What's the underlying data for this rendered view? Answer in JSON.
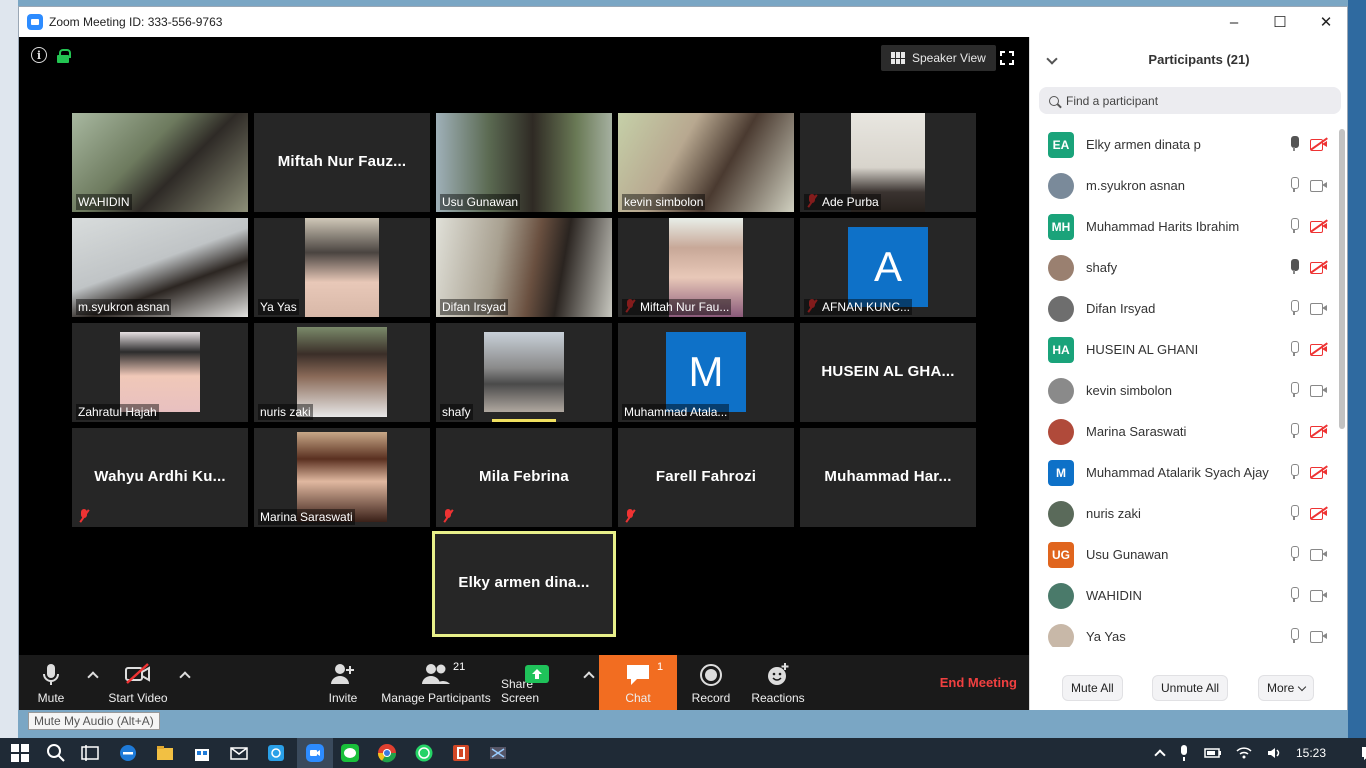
{
  "window": {
    "title": "Zoom Meeting ID: 333-556-9763",
    "controls": [
      "–",
      "☐",
      "✕"
    ]
  },
  "video": {
    "speaker_view_label": "Speaker View",
    "tiles": [
      {
        "name": "WAHIDIN",
        "type": "video",
        "muted": false
      },
      {
        "name": "Miftah Nur Fauz...",
        "type": "name",
        "muted": false
      },
      {
        "name": "Usu Gunawan",
        "type": "video",
        "muted": false
      },
      {
        "name": "kevin simbolon",
        "type": "video",
        "muted": false
      },
      {
        "name": "Ade Purba",
        "type": "video",
        "muted": true
      },
      {
        "name": "m.syukron asnan",
        "type": "video",
        "muted": false
      },
      {
        "name": "Ya Yas",
        "type": "video",
        "muted": false
      },
      {
        "name": "Difan Irsyad",
        "type": "video",
        "muted": false
      },
      {
        "name": "Miftah Nur Fau...",
        "type": "video",
        "muted": true
      },
      {
        "name": "AFNAN KUNC...",
        "type": "avatar",
        "letter": "A",
        "muted": true
      },
      {
        "name": "Zahratul Hajah",
        "type": "video",
        "muted": false
      },
      {
        "name": "nuris zaki",
        "type": "video",
        "muted": false
      },
      {
        "name": "shafy",
        "type": "video",
        "muted": false
      },
      {
        "name": "Muhammad Atala...",
        "type": "avatar",
        "letter": "M",
        "muted": false
      },
      {
        "name": "HUSEIN AL GHA...",
        "type": "name",
        "muted": false
      },
      {
        "name": "Wahyu Ardhi Ku...",
        "type": "name",
        "muted": true
      },
      {
        "name": "Marina Saraswati",
        "type": "video",
        "muted": false
      },
      {
        "name": "Mila Febrina",
        "type": "name",
        "muted": true
      },
      {
        "name": "Farell Fahrozi",
        "type": "name",
        "muted": true
      },
      {
        "name": "Muhammad Har...",
        "type": "name",
        "muted": false
      },
      {
        "name": "Elky armen dina...",
        "type": "name",
        "muted": false,
        "active": true
      }
    ]
  },
  "toolbar": {
    "mute_label": "Mute",
    "start_video_label": "Start Video",
    "invite_label": "Invite",
    "manage_participants_label": "Manage Participants",
    "participants_count": "21",
    "share_screen_label": "Share Screen",
    "chat_label": "Chat",
    "chat_badge": "1",
    "record_label": "Record",
    "reactions_label": "Reactions",
    "end_meeting_label": "End Meeting"
  },
  "tooltip": "Mute My Audio (Alt+A)",
  "panel": {
    "title": "Participants (21)",
    "search_placeholder": "Find a participant",
    "participants": [
      {
        "name": "Elky armen dinata p",
        "initials": "EA",
        "color": "#1aa37a",
        "mic": "on",
        "cam": "off"
      },
      {
        "name": "m.syukron asnan",
        "initials": "",
        "color": "#7a8a9a",
        "mic": "idle",
        "cam": "on"
      },
      {
        "name": "Muhammad Harits Ibrahim",
        "initials": "MH",
        "color": "#1aa37a",
        "mic": "idle",
        "cam": "off"
      },
      {
        "name": "shafy",
        "initials": "",
        "color": "#9a8070",
        "mic": "on",
        "cam": "off"
      },
      {
        "name": "Difan Irsyad",
        "initials": "",
        "color": "#6e6e6e",
        "mic": "idle",
        "cam": "on"
      },
      {
        "name": "HUSEIN AL GHANI",
        "initials": "HA",
        "color": "#1aa37a",
        "mic": "idle",
        "cam": "off"
      },
      {
        "name": "kevin simbolon",
        "initials": "",
        "color": "#8a8a8a",
        "mic": "idle",
        "cam": "on"
      },
      {
        "name": "Marina Saraswati",
        "initials": "",
        "color": "#b04a3a",
        "mic": "idle",
        "cam": "off"
      },
      {
        "name": "Muhammad Atalarik Syach Ajay",
        "initials": "M",
        "color": "#0e71c8",
        "mic": "idle",
        "cam": "off"
      },
      {
        "name": "nuris zaki",
        "initials": "",
        "color": "#5a6a5a",
        "mic": "idle",
        "cam": "off"
      },
      {
        "name": "Usu Gunawan",
        "initials": "UG",
        "color": "#e0651e",
        "mic": "idle",
        "cam": "on"
      },
      {
        "name": "WAHIDIN",
        "initials": "",
        "color": "#4a7a6a",
        "mic": "idle",
        "cam": "on"
      },
      {
        "name": "Ya Yas",
        "initials": "",
        "color": "#c8b8a8",
        "mic": "idle",
        "cam": "on"
      }
    ],
    "mute_all_label": "Mute All",
    "unmute_all_label": "Unmute All",
    "more_label": "More"
  },
  "taskbar": {
    "time": "15:23"
  }
}
